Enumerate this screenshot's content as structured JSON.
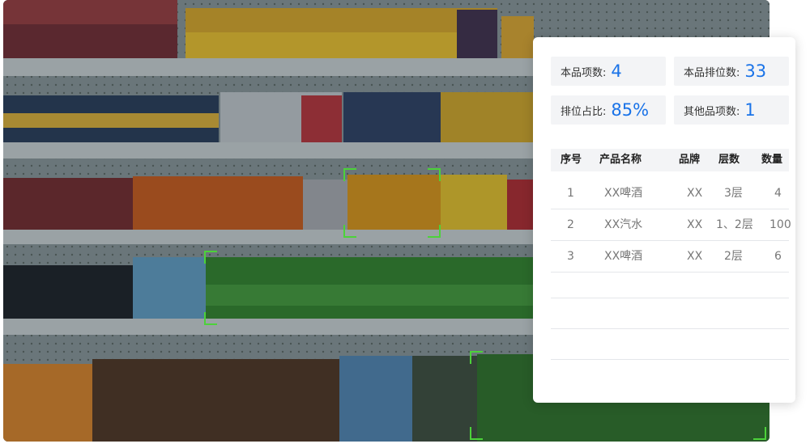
{
  "stats": {
    "item_count_label": "本品项数:",
    "item_count_value": "4",
    "facing_count_label": "本品排位数:",
    "facing_count_value": "33",
    "share_label": "排位占比:",
    "share_value": "85%",
    "other_items_label": "其他品项数:",
    "other_items_value": "1"
  },
  "table": {
    "headers": [
      "序号",
      "产品名称",
      "品牌",
      "层数",
      "数量"
    ],
    "rows": [
      [
        "1",
        "XX啤酒",
        "XX",
        "3层",
        "4"
      ],
      [
        "2",
        "XX汽水",
        "XX",
        "1、2层",
        "100"
      ],
      [
        "3",
        "XX啤酒",
        "XX",
        "2层",
        "6"
      ]
    ]
  },
  "colors": {
    "accent": "#1a73e8",
    "detection": "#4cd23a"
  }
}
